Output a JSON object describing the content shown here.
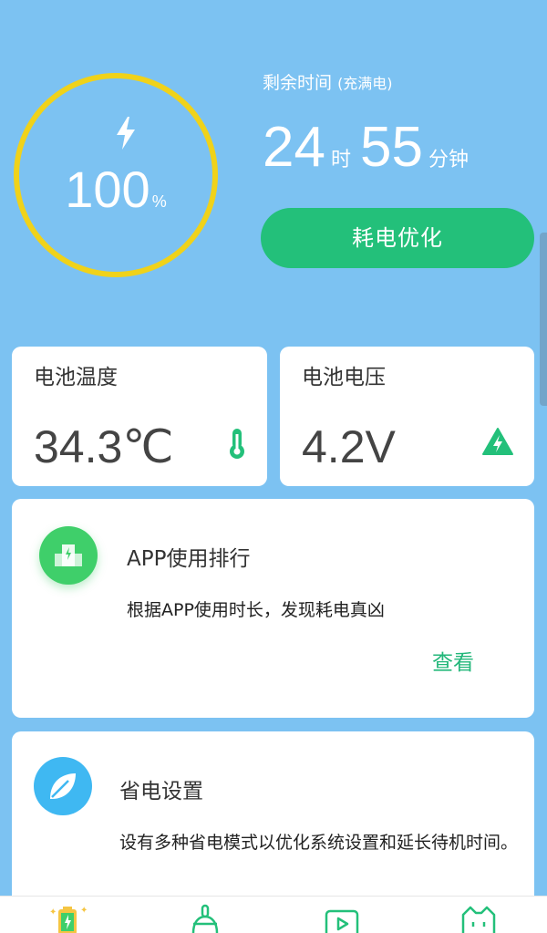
{
  "battery": {
    "percent": "100",
    "percent_sign": "%",
    "level": 1.0
  },
  "remaining": {
    "label": "剩余时间",
    "sublabel": "(充满电)",
    "hours": "24",
    "hours_unit": "时",
    "minutes": "55",
    "minutes_unit": "分钟"
  },
  "optimize_button": "耗电优化",
  "stats": {
    "temperature": {
      "title": "电池温度",
      "value": "34.3℃"
    },
    "voltage": {
      "title": "电池电压",
      "value": "4.2V"
    }
  },
  "cards": {
    "app_ranking": {
      "title": "APP使用排行",
      "description": "根据APP使用时长，发现耗电真凶",
      "action": "查看"
    },
    "power_saving": {
      "title": "省电设置",
      "description": "设有多种省电模式以优化系统设置和延长待机时间。"
    }
  },
  "bottom_nav": {
    "tabs": [
      "battery-tab-icon",
      "broom-tab-icon",
      "video-tab-icon",
      "cat-tab-icon"
    ],
    "active_index": 0
  },
  "colors": {
    "background": "#7cc2f2",
    "ring": "#f0d21a",
    "accent_green": "#23c07a",
    "card_bg": "#ffffff"
  }
}
